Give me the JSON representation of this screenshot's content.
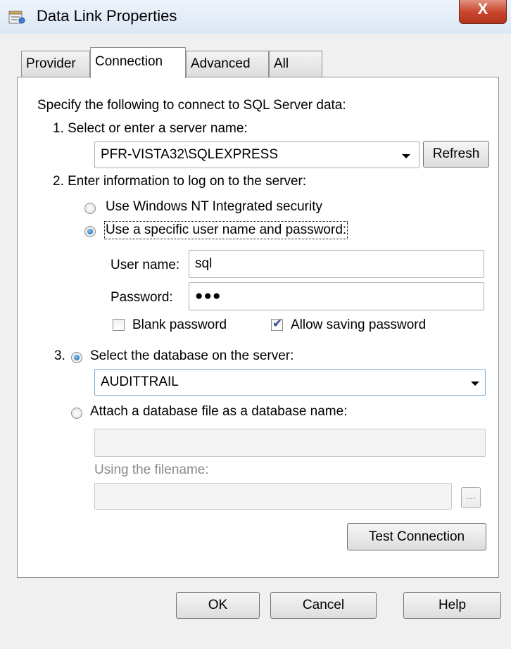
{
  "window": {
    "title": "Data Link Properties",
    "close_label": "X"
  },
  "tabs": [
    {
      "label": "Provider"
    },
    {
      "label": "Connection"
    },
    {
      "label": "Advanced"
    },
    {
      "label": "All"
    }
  ],
  "connection": {
    "intro": "Specify the following to connect to SQL Server data:",
    "step1_label": "1. Select or enter a server name:",
    "server_value": "PFR-VISTA32\\SQLEXPRESS",
    "refresh_label": "Refresh",
    "step2_label": "2. Enter information to log on to the server:",
    "radio_nt_label": "Use Windows NT Integrated security",
    "radio_specific_label": "Use a specific user name and password:",
    "username_label": "User name:",
    "username_value": "sql",
    "password_label": "Password:",
    "password_value": "●●●",
    "blank_password_label": "Blank password",
    "allow_saving_label": "Allow saving password",
    "step3_number": "3.",
    "radio_select_db_label": "Select the database on the server:",
    "database_value": "AUDITTRAIL",
    "radio_attach_label": "Attach a database file as a database name:",
    "attach_name_value": "",
    "using_filename_label": "Using the filename:",
    "filename_value": "",
    "browse_label": "...",
    "test_connection_label": "Test Connection"
  },
  "footer": {
    "ok_label": "OK",
    "cancel_label": "Cancel",
    "help_label": "Help"
  },
  "state": {
    "active_tab": "Connection",
    "login_mode": "specific",
    "blank_password_checked": false,
    "allow_saving_checked": true,
    "database_mode": "select"
  }
}
